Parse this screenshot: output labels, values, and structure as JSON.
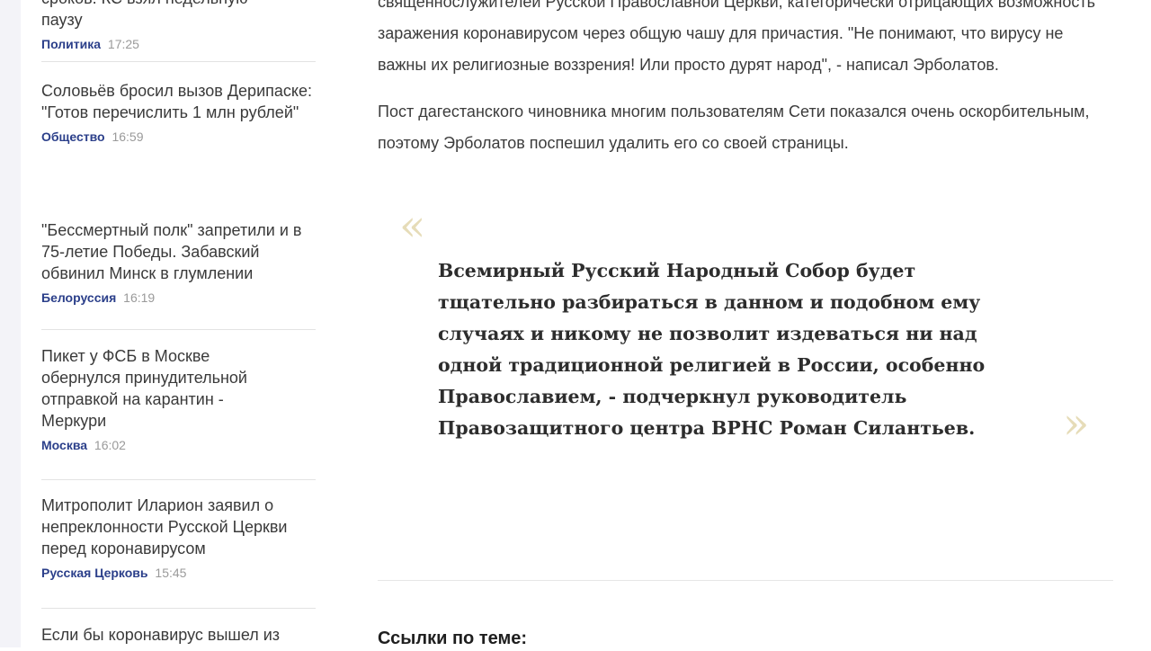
{
  "sidebar": {
    "items": [
      {
        "title": "сроков. КС взял недельную паузу",
        "category": "Политика",
        "time": "17:25"
      },
      {
        "title": "Соловьёв бросил вызов Дерипаске: \"Готов перечислить 1 млн рублей\"",
        "category": "Общество",
        "time": "16:59"
      },
      {
        "title": "\"Бессмертный полк\" запретили и в 75-летие Победы. Забавский обвинил Минск в глумлении",
        "category": "Белоруссия",
        "time": "16:19"
      },
      {
        "title": "Пикет у ФСБ в Москве обернулся принудительной отправкой на карантин - Меркури",
        "category": "Москва",
        "time": "16:02"
      },
      {
        "title": "Митрополит Иларион заявил о непреклонности Русской Церкви перед коронавирусом",
        "category": "Русская Церковь",
        "time": "15:45"
      },
      {
        "title": "Если бы коронавирус вышел из",
        "category": "",
        "time": ""
      }
    ]
  },
  "article": {
    "paragraph1": "священнослужителей Русской Православной Церкви, категорически отрицающих возможность заражения коронавирусом через общую чашу для причастия. \"Не понимают, что вирусу не важны их религиозные воззрения! Или просто дурят народ\", - написал Эрболатов.",
    "paragraph2": "Пост дагестанского чиновника многим пользователям Сети показался очень оскорбительным, поэтому Эрболатов поспешил удалить его со своей страницы.",
    "quote": {
      "open_mark": "«",
      "close_mark": "»",
      "text": "Всемирный Русский Народный Собор будет тщательно разбираться в данном и подобном ему случаях и никому не позволит издеваться ни над одной традиционной религией в России, особенно Православием, - подчеркнул руководитель Правозащитного центра ВРНС Роман Силантьев."
    },
    "related_heading": "Ссылки по теме:"
  },
  "colors": {
    "category_link": "#2b3f8a",
    "quote_mark": "#e6dcb8",
    "timestamp": "#9a9a9a"
  }
}
